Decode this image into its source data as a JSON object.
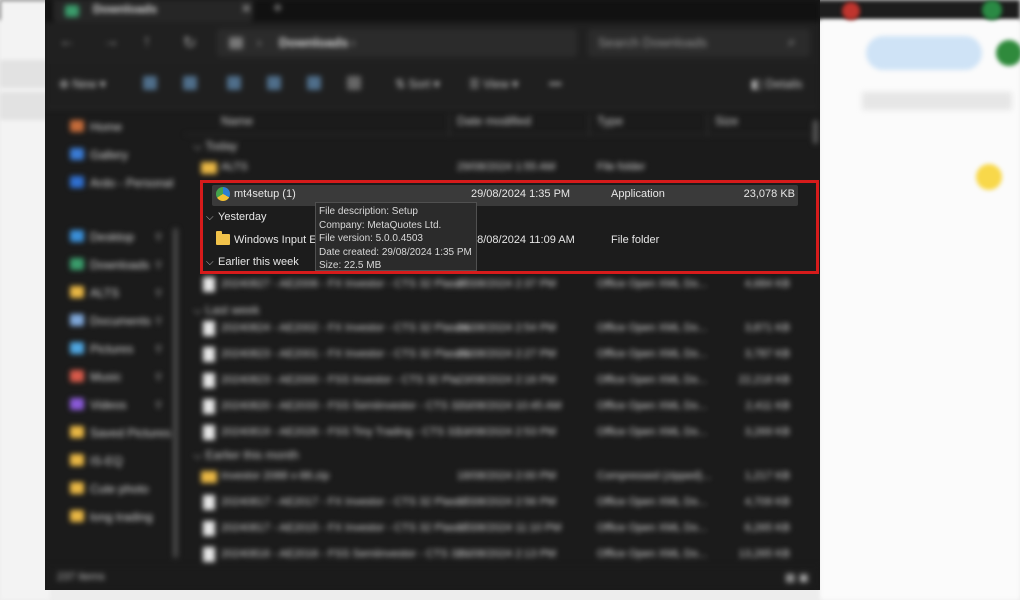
{
  "window": {
    "tab_title": "Downloads",
    "breadcrumb": "Downloads",
    "search_placeholder": "Search Downloads"
  },
  "toolbar": {
    "new_label": "New",
    "sort_label": "Sort",
    "view_label": "View",
    "more_label": "•••",
    "details_label": "Details"
  },
  "sidebar": {
    "items": [
      {
        "label": "Home",
        "color": "#c46b3a"
      },
      {
        "label": "Gallery",
        "color": "#3a7bd5"
      },
      {
        "label": "Ardo - Personal",
        "color": "#2f6fd0"
      },
      {
        "label": "Desktop",
        "color": "#3a8fd8"
      },
      {
        "label": "Downloads",
        "color": "#3a9c6b"
      },
      {
        "label": "ALTS",
        "color": "#e9b744"
      },
      {
        "label": "Documents",
        "color": "#7fa7d9"
      },
      {
        "label": "Pictures",
        "color": "#4fa6e0"
      },
      {
        "label": "Music",
        "color": "#d85a4a"
      },
      {
        "label": "Videos",
        "color": "#8a5ad8"
      },
      {
        "label": "Saved Pictures",
        "color": "#e9b744"
      },
      {
        "label": "IS-EQ",
        "color": "#e9b744"
      },
      {
        "label": "Cute photo",
        "color": "#e9b744"
      },
      {
        "label": "long trading",
        "color": "#e9b744"
      }
    ]
  },
  "columns": {
    "name": "Name",
    "date": "Date modified",
    "type": "Type",
    "size": "Size"
  },
  "groups": {
    "today": "Today",
    "yesterday": "Yesterday",
    "earlier_week": "Earlier this week",
    "last_week": "Last week",
    "earlier_month": "Earlier this month"
  },
  "files": {
    "today_folder": {
      "name": "ALTS",
      "date": "29/08/2024 1:55 AM",
      "type": "File folder",
      "size": ""
    },
    "selected": {
      "name": "mt4setup (1)",
      "date": "29/08/2024 1:35 PM",
      "type": "Application",
      "size": "23,078 KB"
    },
    "windows_input": {
      "name": "Windows Input Experience",
      "date": "28/08/2024 11:09 AM",
      "type": "File folder",
      "size": ""
    },
    "earlier_week": [
      {
        "name": "20240827 - AE2006 - FX Investor - CTS 32 Plasmi...",
        "date": "27/08/2024 2:37 PM",
        "type": "Office Open XML Do...",
        "size": "4,684 KB"
      }
    ],
    "last_week": [
      {
        "name": "20240824 - AE2002 - FX Investor - CTS 32 Plasmi...",
        "date": "24/08/2024 2:54 PM",
        "type": "Office Open XML Do...",
        "size": "3,871 KB"
      },
      {
        "name": "20240823 - AE2001 - FX Investor - CTS 32 Plasmi...",
        "date": "23/08/2024 2:27 PM",
        "type": "Office Open XML Do...",
        "size": "3,787 KB"
      },
      {
        "name": "20240823 - AE2000 - FSS Investor - CTS 32 Pla...",
        "date": "23/08/2024 2:16 PM",
        "type": "Office Open XML Do...",
        "size": "22,218 KB"
      },
      {
        "name": "20240820 - AE2033 - FSS Semiinvestor - CTS 32...",
        "date": "20/08/2024 10:45 AM",
        "type": "Office Open XML Do...",
        "size": "2,411 KB"
      },
      {
        "name": "20240819 - AE2026 - FSS Tiny Trading - CTS 32...",
        "date": "19/08/2024 2:53 PM",
        "type": "Office Open XML Do...",
        "size": "3,269 KB"
      }
    ],
    "earlier_month": [
      {
        "name": "Investor 2088 v-88.zip",
        "date": "18/08/2024 2:00 PM",
        "type": "Compressed (zipped)...",
        "size": "1,217 KB"
      },
      {
        "name": "20240817 - AE2017 - FX Investor - CTS 32 Plasmi...",
        "date": "17/08/2024 2:56 PM",
        "type": "Office Open XML Do...",
        "size": "4,709 KB"
      },
      {
        "name": "20240817 - AE2015 - FX Investor - CTS 32 Plasmi...",
        "date": "17/08/2024 11:10 PM",
        "type": "Office Open XML Do...",
        "size": "6,265 KB"
      },
      {
        "name": "20240816 - AE2016 - FSS Semiinvestor - CTS 32...",
        "date": "16/08/2024 2:13 PM",
        "type": "Office Open XML Do...",
        "size": "13,265 KB"
      }
    ]
  },
  "tooltip": {
    "description": "File description: Setup",
    "company": "Company: MetaQuotes Ltd.",
    "version": "File version: 5.0.0.4503",
    "created": "Date created: 29/08/2024 1:35 PM",
    "size": "Size: 22.5 MB"
  },
  "status": {
    "item_count": "237 items"
  },
  "colors": {
    "highlight_border": "#d61b1b",
    "window_bg": "#1b1b1b",
    "selection_bg": "#3a3a3a"
  }
}
